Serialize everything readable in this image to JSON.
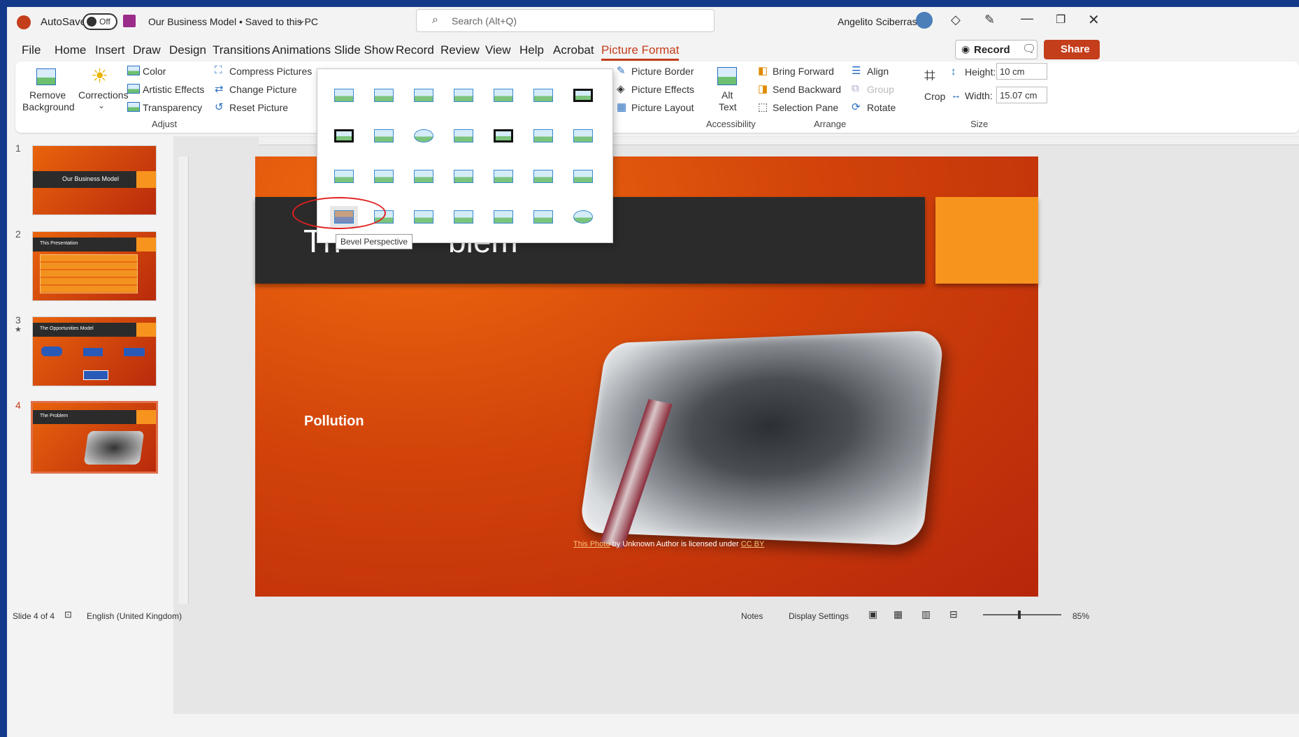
{
  "titlebar": {
    "autosave_label": "AutoSave",
    "autosave_state": "Off",
    "doc_title": "Our Business Model • Saved to this PC",
    "search_placeholder": "Search (Alt+Q)",
    "user_name": "Angelito Sciberras"
  },
  "tabs": [
    "File",
    "Home",
    "Insert",
    "Draw",
    "Design",
    "Transitions",
    "Animations",
    "Slide Show",
    "Record",
    "Review",
    "View",
    "Help",
    "Acrobat",
    "Picture Format"
  ],
  "actions": {
    "record": "Record",
    "share": "Share"
  },
  "ribbon": {
    "remove_background": [
      "Remove",
      "Background"
    ],
    "corrections": "Corrections",
    "color": "Color",
    "artistic_effects": "Artistic Effects",
    "transparency": "Transparency",
    "compress_pictures": "Compress Pictures",
    "change_picture": "Change Picture",
    "reset_picture": "Reset Picture",
    "adjust_group": "Adjust",
    "picture_border": "Picture Border",
    "picture_effects": "Picture Effects",
    "picture_layout": "Picture Layout",
    "alt_text": [
      "Alt",
      "Text"
    ],
    "accessibility_group": "Accessibility",
    "bring_forward": "Bring Forward",
    "send_backward": "Send Backward",
    "selection_pane": "Selection Pane",
    "align": "Align",
    "group": "Group",
    "rotate": "Rotate",
    "arrange_group": "Arrange",
    "crop": "Crop",
    "height_label": "Height:",
    "height_value": "10 cm",
    "width_label": "Width:",
    "width_value": "15.07 cm",
    "size_group": "Size"
  },
  "gallery": {
    "tooltip": "Bevel Perspective"
  },
  "slides": [
    {
      "number": "1",
      "title": "Our Business Model"
    },
    {
      "number": "2",
      "title": "This Presentation"
    },
    {
      "number": "3",
      "title": "The Opportunities Model"
    },
    {
      "number": "4",
      "title": "The Problem"
    }
  ],
  "main_slide": {
    "title_visible": "Th            blem",
    "body_text": "Pollution",
    "caption_link1": "This Photo",
    "caption_mid": " by Unknown Author is licensed under ",
    "caption_link2": "CC BY"
  },
  "status": {
    "slide_info": "Slide 4 of 4",
    "language": "English (United Kingdom)",
    "notes": "Notes",
    "display_settings": "Display Settings",
    "zoom": "85%"
  },
  "colors": {
    "accent": "#c43e1c",
    "brand_orange": "#e9640c",
    "active_tab": "#c43e1c",
    "highlight": "#e02020"
  }
}
